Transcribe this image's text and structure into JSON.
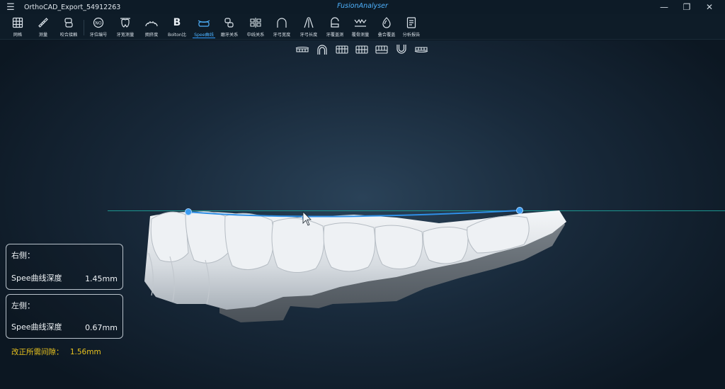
{
  "window": {
    "doc_title": "OrthoCAD_Export_54912263",
    "app_name": "FusionAnalyser"
  },
  "toolbar": {
    "tools": [
      {
        "label": "网格",
        "icon": "grid-icon"
      },
      {
        "label": "测量",
        "icon": "ruler-icon"
      },
      {
        "label": "咬合接触",
        "icon": "occlusion-contact-icon"
      },
      {
        "label": "牙位编号",
        "icon": "tooth-number-icon"
      },
      {
        "label": "牙宽测量",
        "icon": "tooth-width-icon"
      },
      {
        "label": "拥挤度",
        "icon": "crowding-icon"
      },
      {
        "label": "Bolton比",
        "icon": "bolton-icon"
      },
      {
        "label": "Spee曲线",
        "icon": "spee-curve-icon"
      },
      {
        "label": "磨牙关系",
        "icon": "molar-relation-icon"
      },
      {
        "label": "中线关系",
        "icon": "midline-icon"
      },
      {
        "label": "牙弓宽度",
        "icon": "arch-width-icon"
      },
      {
        "label": "牙弓长度",
        "icon": "arch-length-icon"
      },
      {
        "label": "牙覆盖测",
        "icon": "overjet-icon"
      },
      {
        "label": "覆骨测量",
        "icon": "overbite-icon"
      },
      {
        "label": "叠合覆盖",
        "icon": "superimpose-icon"
      },
      {
        "label": "分析报告",
        "icon": "report-icon"
      }
    ],
    "active": "Spee曲线"
  },
  "view_buttons": [
    "front-view-icon",
    "occlusal-view-icon",
    "left-view-icon",
    "right-view-icon",
    "back-view-icon",
    "lower-occlusal-icon",
    "bottom-view-icon"
  ],
  "right_panel": {
    "header": "右侧：",
    "name": "Spee曲线深度",
    "value": "1.45mm"
  },
  "left_panel": {
    "header": "左侧：",
    "name": "Spee曲线深度",
    "value": "0.67mm"
  },
  "correction": {
    "label": "改正所需间隙：",
    "value": "1.56mm"
  },
  "colors": {
    "accent": "#2f9bff",
    "highlight": "#e8c21f",
    "reference_line": "#1ea39a"
  }
}
